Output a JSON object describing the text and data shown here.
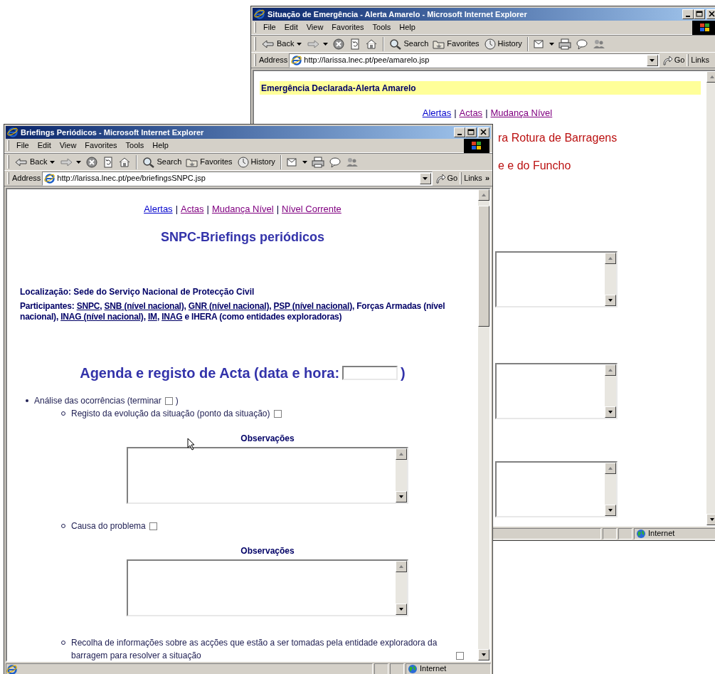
{
  "windows": [
    {
      "title": "Situação de Emergência - Alerta Amarelo - Microsoft Internet Explorer",
      "menu": [
        "File",
        "Edit",
        "View",
        "Favorites",
        "Tools",
        "Help"
      ],
      "toolbar": [
        {
          "kind": "back",
          "label": "Back"
        },
        {
          "kind": "forward"
        },
        {
          "kind": "stop"
        },
        {
          "kind": "refresh"
        },
        {
          "kind": "home"
        },
        {
          "kind": "sep"
        },
        {
          "kind": "search",
          "label": "Search"
        },
        {
          "kind": "favorites",
          "label": "Favorites"
        },
        {
          "kind": "history",
          "label": "History"
        },
        {
          "kind": "sep"
        },
        {
          "kind": "mail"
        },
        {
          "kind": "print"
        },
        {
          "kind": "discuss"
        },
        {
          "kind": "messenger"
        }
      ],
      "address_label": "Address",
      "url": "http://larissa.lnec.pt/pee/amarelo.jsp",
      "go_label": "Go",
      "links_label": "Links",
      "page": {
        "banner": "Emergência Declarada-Alerta Amarelo",
        "nav": [
          {
            "text": "Alertas",
            "visited": false
          },
          {
            "kind": "separator",
            "text": "|"
          },
          {
            "text": "Actas",
            "visited": true
          },
          {
            "kind": "separator",
            "text": "|"
          },
          {
            "text": "Mudança Nível",
            "visited": true
          }
        ],
        "headings": [
          "ra Rotura de Barragens",
          "e e do Funcho"
        ]
      },
      "status": "Internet"
    },
    {
      "title": "Briefings Periódicos - Microsoft Internet Explorer",
      "menu": [
        "File",
        "Edit",
        "View",
        "Favorites",
        "Tools",
        "Help"
      ],
      "toolbar": [
        {
          "kind": "back",
          "label": "Back"
        },
        {
          "kind": "forward"
        },
        {
          "kind": "stop"
        },
        {
          "kind": "refresh"
        },
        {
          "kind": "home"
        },
        {
          "kind": "sep"
        },
        {
          "kind": "search",
          "label": "Search"
        },
        {
          "kind": "favorites",
          "label": "Favorites"
        },
        {
          "kind": "history",
          "label": "History"
        },
        {
          "kind": "sep"
        },
        {
          "kind": "mail"
        },
        {
          "kind": "print"
        },
        {
          "kind": "discuss"
        },
        {
          "kind": "messenger"
        }
      ],
      "address_label": "Address",
      "url": "http://larissa.lnec.pt/pee/briefingsSNPC.jsp",
      "go_label": "Go",
      "links_label": "Links",
      "links_chevron": "»",
      "page": {
        "nav": [
          {
            "text": "Alertas",
            "visited": false
          },
          {
            "kind": "separator",
            "text": "|"
          },
          {
            "text": "Actas",
            "visited": true
          },
          {
            "kind": "separator",
            "text": "|"
          },
          {
            "text": "Mudança Nível",
            "visited": true
          },
          {
            "kind": "separator",
            "text": "|"
          },
          {
            "text": "Nível Corrente",
            "visited": true
          }
        ],
        "title": "SNPC-Briefings periódicos",
        "location": "Localização: Sede do Serviço Nacional de Protecção Civil",
        "participants": [
          {
            "text": "Participantes: "
          },
          {
            "kind": "link",
            "text": "SNPC"
          },
          {
            "text": ", "
          },
          {
            "kind": "link",
            "text": "SNB (nível nacional)"
          },
          {
            "text": ", "
          },
          {
            "kind": "link",
            "text": "GNR (nível nacional)"
          },
          {
            "text": ", "
          },
          {
            "kind": "link",
            "text": "PSP (nível nacional)"
          },
          {
            "text": ", Forças Armadas (nível nacional), "
          },
          {
            "kind": "link",
            "text": "INAG (nível nacional)"
          },
          {
            "text": ", "
          },
          {
            "kind": "link",
            "text": "IM"
          },
          {
            "text": ", "
          },
          {
            "kind": "link",
            "text": "INAG"
          },
          {
            "text": " e IHERA (como entidades exploradoras)"
          }
        ],
        "agenda_title": "Agenda e registo de Acta (data e hora:",
        "agenda_close": ")",
        "items": [
          {
            "text": "Análise das ocorrências (terminar",
            "checked": false,
            "after": ")",
            "children": [
              {
                "text": "Registo da evolução da situação (ponto da situação)",
                "checked": false,
                "notes_label": "Observações"
              },
              {
                "text": "Causa do problema",
                "checked": false,
                "notes_label": "Observações"
              },
              {
                "text": "Recolha de informações sobre as acções que estão a ser tomadas pela entidade exploradora da barragem para resolver a situação",
                "checked": false
              }
            ]
          }
        ]
      },
      "status": "Internet"
    }
  ]
}
